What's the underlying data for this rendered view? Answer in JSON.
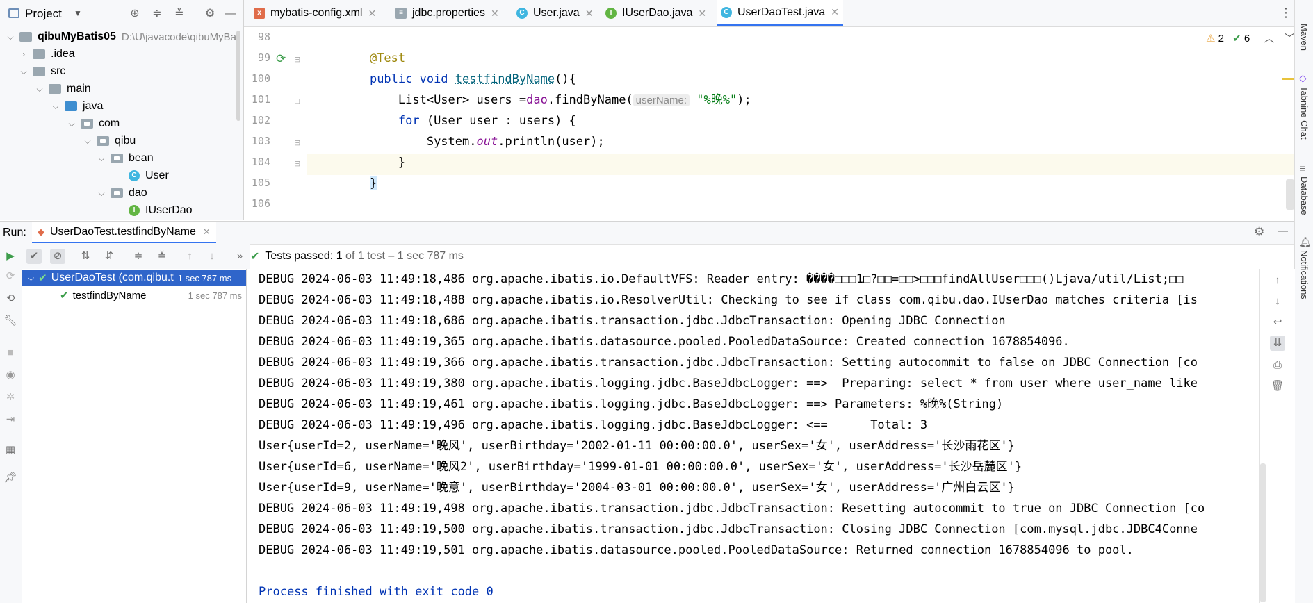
{
  "project": {
    "title": "Project",
    "tree": [
      {
        "label": "qibuMyBatis05",
        "path": "D:\\U\\javacode\\qibuMyBa"
      },
      {
        "label": ".idea"
      },
      {
        "label": "src"
      },
      {
        "label": "main"
      },
      {
        "label": "java"
      },
      {
        "label": "com"
      },
      {
        "label": "qibu"
      },
      {
        "label": "bean"
      },
      {
        "label": "User"
      },
      {
        "label": "dao"
      },
      {
        "label": "IUserDao"
      }
    ]
  },
  "editor": {
    "tabs": [
      {
        "label": "mybatis-config.xml",
        "icon": "xml-icon"
      },
      {
        "label": "jdbc.properties",
        "icon": "properties-icon"
      },
      {
        "label": "User.java",
        "icon": "class-icon"
      },
      {
        "label": "IUserDao.java",
        "icon": "interface-icon"
      },
      {
        "label": "UserDaoTest.java",
        "icon": "class-icon",
        "active": true
      }
    ],
    "line_numbers": [
      "98",
      "99",
      "100",
      "101",
      "102",
      "103",
      "104",
      "105",
      "106"
    ],
    "code": {
      "l98": "@Test",
      "l99_kw": "public void ",
      "l99_fn": "testfindByName",
      "l99_tail": "(){",
      "l100_a": "    List<User> users =",
      "l100_fld": "dao",
      "l100_b": ".findByName(",
      "l100_hint": "userName:",
      "l100_str": "\"%晚%\"",
      "l100_c": ");",
      "l101_kw": "    for",
      "l101_rest": " (User user : users) {",
      "l102_a": "        System.",
      "l102_it": "out",
      "l102_b": ".println(user);",
      "l103": "    }",
      "l104": "}"
    },
    "inspections": {
      "warnings": "2",
      "weak_warnings": "6"
    }
  },
  "run": {
    "label": "Run:",
    "tab": "UserDaoTest.testfindByName",
    "status": {
      "prefix": "Tests passed: ",
      "count": "1",
      "suffix": " of 1 test – 1 sec 787 ms"
    },
    "tests": [
      {
        "name": "UserDaoTest (com.qibu.t",
        "time": "1 sec 787 ms"
      },
      {
        "name": "testfindByName",
        "time": "1 sec 787 ms"
      }
    ],
    "console": [
      "DEBUG 2024-06-03 11:49:18,486 org.apache.ibatis.io.DefaultVFS: Reader entry: ����□□□1□?□□=□□>□□□findAllUser□□□()Ljava/util/List;□□",
      "DEBUG 2024-06-03 11:49:18,488 org.apache.ibatis.io.ResolverUtil: Checking to see if class com.qibu.dao.IUserDao matches criteria [is",
      "DEBUG 2024-06-03 11:49:18,686 org.apache.ibatis.transaction.jdbc.JdbcTransaction: Opening JDBC Connection",
      "DEBUG 2024-06-03 11:49:19,365 org.apache.ibatis.datasource.pooled.PooledDataSource: Created connection 1678854096.",
      "DEBUG 2024-06-03 11:49:19,366 org.apache.ibatis.transaction.jdbc.JdbcTransaction: Setting autocommit to false on JDBC Connection [co",
      "DEBUG 2024-06-03 11:49:19,380 org.apache.ibatis.logging.jdbc.BaseJdbcLogger: ==>  Preparing: select * from user where user_name like",
      "DEBUG 2024-06-03 11:49:19,461 org.apache.ibatis.logging.jdbc.BaseJdbcLogger: ==> Parameters: %晚%(String)",
      "DEBUG 2024-06-03 11:49:19,496 org.apache.ibatis.logging.jdbc.BaseJdbcLogger: <==      Total: 3",
      "User{userId=2, userName='晚风', userBirthday='2002-01-11 00:00:00.0', userSex='女', userAddress='长沙雨花区'}",
      "User{userId=6, userName='晚风2', userBirthday='1999-01-01 00:00:00.0', userSex='女', userAddress='长沙岳麓区'}",
      "User{userId=9, userName='晚意', userBirthday='2004-03-01 00:00:00.0', userSex='女', userAddress='广州白云区'}",
      "DEBUG 2024-06-03 11:49:19,498 org.apache.ibatis.transaction.jdbc.JdbcTransaction: Resetting autocommit to true on JDBC Connection [co",
      "DEBUG 2024-06-03 11:49:19,500 org.apache.ibatis.transaction.jdbc.JdbcTransaction: Closing JDBC Connection [com.mysql.jdbc.JDBC4Conne",
      "DEBUG 2024-06-03 11:49:19,501 org.apache.ibatis.datasource.pooled.PooledDataSource: Returned connection 1678854096 to pool."
    ],
    "exit": "Process finished with exit code 0"
  },
  "side_tools": [
    "Maven",
    "Tabnine Chat",
    "Database",
    "Notifications"
  ],
  "colors": {
    "accent": "#3574f0",
    "selection": "#2f65ca",
    "pass": "#3d9d4b"
  }
}
